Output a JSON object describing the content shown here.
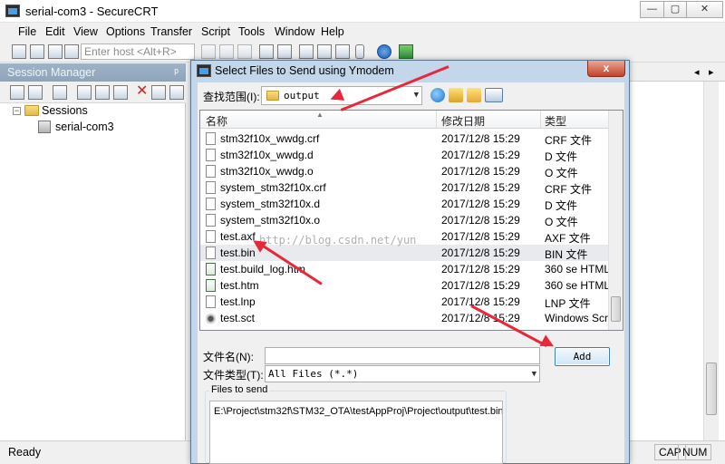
{
  "app": {
    "title": "serial-com3 - SecureCRT",
    "window_controls": [
      "—",
      "▢",
      "✕"
    ]
  },
  "menu": [
    "File",
    "Edit",
    "View",
    "Options",
    "Transfer",
    "Script",
    "Tools",
    "Window",
    "Help"
  ],
  "toolbar": {
    "host_placeholder": "Enter host <Alt+R>"
  },
  "session_manager": {
    "title": "Session Manager",
    "pin": "ᵖ",
    "tree": {
      "root": "Sessions",
      "child": "serial-com3"
    }
  },
  "terminal_tabs": {
    "prev": "◂",
    "next": "▸"
  },
  "statusbar": {
    "status": "Ready",
    "cap": "CAP",
    "num": "NUM"
  },
  "dialog": {
    "title": "Select Files to Send using Ymodem",
    "close": "x",
    "look_in_label": "查找范围(I):",
    "look_in_value": "output",
    "columns": [
      "名称",
      "修改日期",
      "类型"
    ],
    "files": [
      {
        "name": "stm32f10x_wwdg.crf",
        "date": "2017/12/8 15:29",
        "type": "CRF 文件",
        "icon": "file-icon"
      },
      {
        "name": "stm32f10x_wwdg.d",
        "date": "2017/12/8 15:29",
        "type": "D 文件",
        "icon": "file-icon"
      },
      {
        "name": "stm32f10x_wwdg.o",
        "date": "2017/12/8 15:29",
        "type": "O 文件",
        "icon": "file-icon"
      },
      {
        "name": "system_stm32f10x.crf",
        "date": "2017/12/8 15:29",
        "type": "CRF 文件",
        "icon": "file-icon"
      },
      {
        "name": "system_stm32f10x.d",
        "date": "2017/12/8 15:29",
        "type": "D 文件",
        "icon": "file-icon"
      },
      {
        "name": "system_stm32f10x.o",
        "date": "2017/12/8 15:29",
        "type": "O 文件",
        "icon": "file-icon"
      },
      {
        "name": "test.axf",
        "date": "2017/12/8 15:29",
        "type": "AXF 文件",
        "icon": "file-icon"
      },
      {
        "name": "test.bin",
        "date": "2017/12/8 15:29",
        "type": "BIN 文件",
        "icon": "file-icon",
        "selected": true
      },
      {
        "name": "test.build_log.htm",
        "date": "2017/12/8 15:29",
        "type": "360 se HTML",
        "icon": "html-file-icon"
      },
      {
        "name": "test.htm",
        "date": "2017/12/8 15:29",
        "type": "360 se HTML",
        "icon": "html-file-icon"
      },
      {
        "name": "test.lnp",
        "date": "2017/12/8 15:29",
        "type": "LNP 文件",
        "icon": "file-icon"
      },
      {
        "name": "test.sct",
        "date": "2017/12/8 15:29",
        "type": "Windows Scr",
        "icon": "script-file-icon"
      }
    ],
    "filename_label": "文件名(N):",
    "filename_value": "",
    "filetype_label": "文件类型(T):",
    "filetype_value": "All Files (*.*)",
    "add_button": "Add",
    "files_to_send_label": "Files to send",
    "files_to_send": [
      "E:\\Project\\stm32f\\STM32_OTA\\testAppProj\\Project\\output\\test.bin"
    ],
    "watermark": "http://blog.csdn.net/yun"
  },
  "colors": {
    "dialog_frame": "#c4d6ea",
    "annotation_arrow": "#e8283a",
    "session_header": "#9fb3c7",
    "add_button_border": "#3c7fb1"
  }
}
